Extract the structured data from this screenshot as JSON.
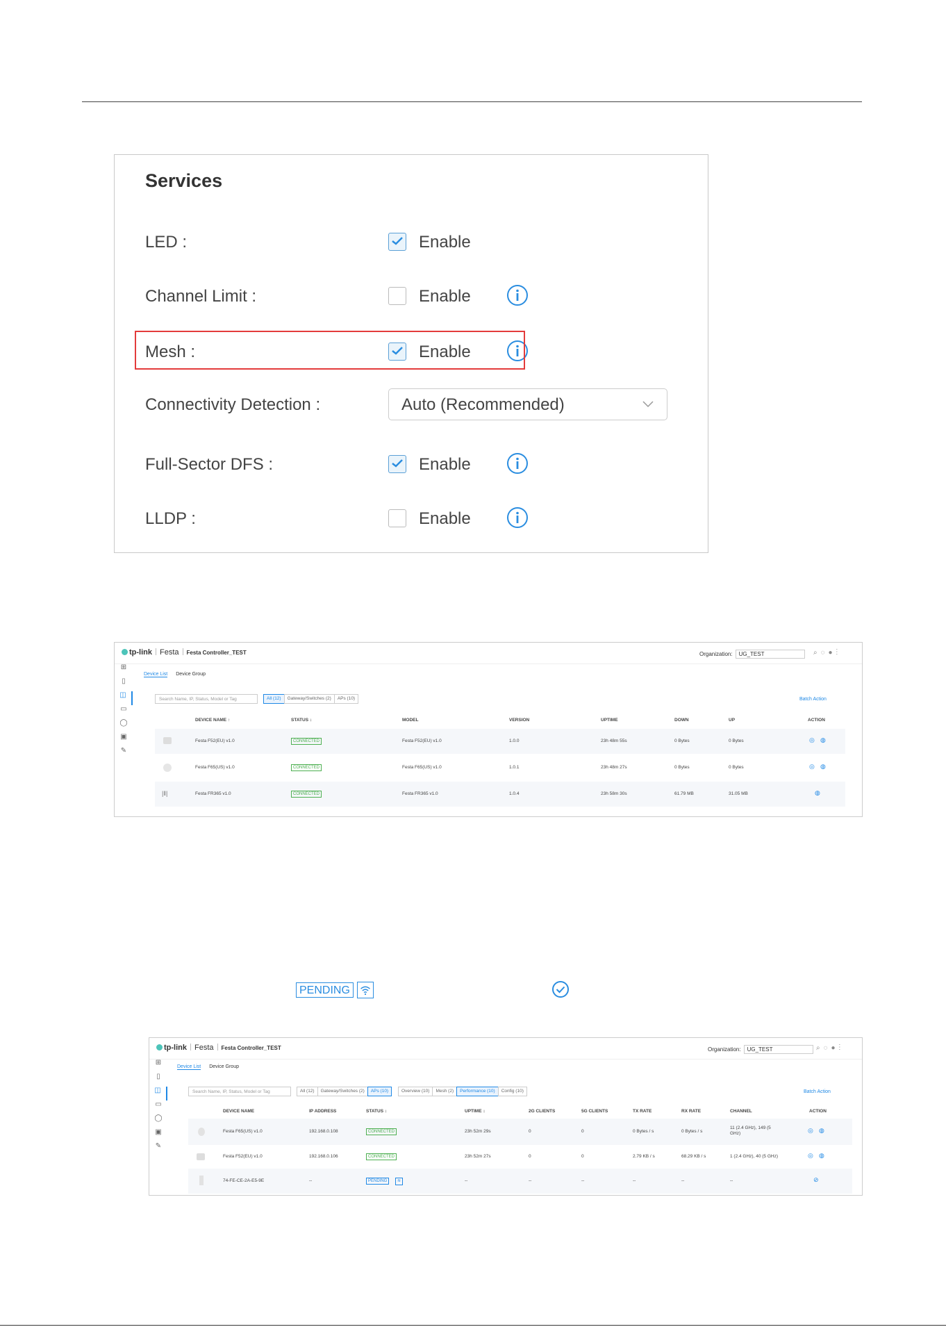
{
  "services": {
    "title": "Services",
    "rows": [
      {
        "label": "LED :",
        "checked": true,
        "option": "Enable",
        "info": false
      },
      {
        "label": "Channel Limit :",
        "checked": false,
        "option": "Enable",
        "info": true
      },
      {
        "label": "Mesh :",
        "checked": true,
        "option": "Enable",
        "info": true
      },
      {
        "label": "Connectivity Detection :",
        "select": "Auto (Recommended)"
      },
      {
        "label": "Full-Sector DFS :",
        "checked": true,
        "option": "Enable",
        "info": true
      },
      {
        "label": "LLDP :",
        "checked": false,
        "option": "Enable",
        "info": true
      }
    ],
    "highlight_color": "#e33b3b",
    "accent_color": "#2a8de0"
  },
  "controller1": {
    "brand": "tp-link",
    "product": "Festa",
    "controller": "Festa Controller_TEST",
    "org_label": "Organization:",
    "org_value": "UG_TEST",
    "tabs": [
      "Device List",
      "Device Group"
    ],
    "search_placeholder": "Search Name, IP, Status, Model or Tag",
    "filters": [
      "All (12)",
      "Gateway/Switches (2)",
      "APs (10)"
    ],
    "batch": "Batch Action",
    "headers": [
      "DEVICE NAME ↑",
      "STATUS ↕",
      "MODEL",
      "VERSION",
      "UPTIME",
      "DOWN",
      "UP",
      "ACTION"
    ],
    "rows": [
      {
        "name": "Festa F52(EU) v1.0",
        "status": "CONNECTED",
        "model": "Festa F52(EU) v1.0",
        "version": "1.0.0",
        "uptime": "23h 48m 55s",
        "down": "0 Bytes",
        "up": "0 Bytes"
      },
      {
        "name": "Festa F65(US) v1.0",
        "status": "CONNECTED",
        "model": "Festa F65(US) v1.0",
        "version": "1.0.1",
        "uptime": "23h 48m 27s",
        "down": "0 Bytes",
        "up": "0 Bytes"
      },
      {
        "name": "Festa FR365 v1.0",
        "status": "CONNECTED",
        "model": "Festa FR365 v1.0",
        "version": "1.0.4",
        "uptime": "23h 58m 30s",
        "down": "61.79 MB",
        "up": "31.05 MB"
      }
    ]
  },
  "legend": {
    "pending": "PENDING"
  },
  "controller2": {
    "brand": "tp-link",
    "product": "Festa",
    "controller": "Festa Controller_TEST",
    "org_label": "Organization:",
    "org_value": "UG_TEST",
    "tabs": [
      "Device List",
      "Device Group"
    ],
    "search_placeholder": "Search Name, IP, Status, Model or Tag",
    "filters": [
      "All (12)",
      "Gateway/Switches (2)",
      "APs (10)"
    ],
    "views": [
      "Overview (10)",
      "Mesh (2)",
      "Performance (10)",
      "Config (10)"
    ],
    "batch": "Batch Action",
    "headers": [
      "DEVICE NAME",
      "IP ADDRESS",
      "STATUS ↕",
      "UPTIME ↕",
      "2G CLIENTS",
      "5G CLIENTS",
      "TX RATE",
      "RX RATE",
      "CHANNEL",
      "ACTION"
    ],
    "rows": [
      {
        "name": "Festa F65(US) v1.0",
        "ip": "192.168.0.108",
        "status": "CONNECTED",
        "uptime": "23h 52m 29s",
        "c2g": "0",
        "c5g": "0",
        "tx": "0 Bytes / s",
        "rx": "0 Bytes / s",
        "channel": "11 (2.4 GHz), 149 (5 GHz)"
      },
      {
        "name": "Festa F52(EU) v1.0",
        "ip": "192.168.0.106",
        "status": "CONNECTED",
        "uptime": "23h 52m 27s",
        "c2g": "0",
        "c5g": "0",
        "tx": "2.79 KB / s",
        "rx": "68.29 KB / s",
        "channel": "1 (2.4 GHz), 40 (5 GHz)"
      },
      {
        "name": "74-FE-CE-2A-E5-9E",
        "ip": "--",
        "status": "PENDING",
        "uptime": "--",
        "c2g": "--",
        "c5g": "--",
        "tx": "--",
        "rx": "--",
        "channel": "--"
      }
    ]
  }
}
